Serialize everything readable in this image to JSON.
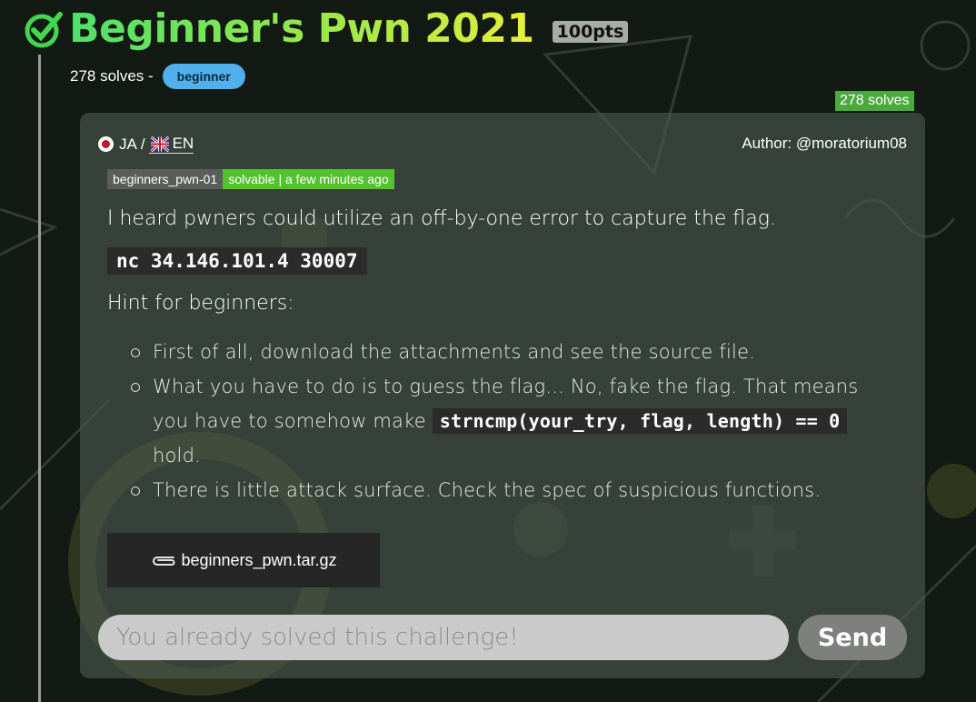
{
  "challenge": {
    "title": "Beginner's Pwn 2021",
    "points": "100pts",
    "solves_meta": "278 solves -",
    "tag": "beginner",
    "solves_badge": "278 solves"
  },
  "card": {
    "lang_ja": "JA",
    "lang_sep": "/",
    "lang_en": "EN",
    "author": "Author: @moratorium08",
    "status_id": "beginners_pwn-01",
    "status_text": "solvable | a few minutes ago",
    "description": "I heard pwners could utilize an off-by-one error to capture the flag.",
    "connection": "nc 34.146.101.4 30007",
    "hint_title": "Hint for beginners:",
    "hints": {
      "h1": "First of all, download the attachments and see the source file.",
      "h2_before": "What you have to do is to guess the flag... No, fake the flag. That means you have to somehow make",
      "h2_code": "strncmp(your_try, flag, length) == 0",
      "h2_after": "hold.",
      "h3": "There is little attack surface. Check the spec of suspicious functions."
    },
    "attachment": "beginners_pwn.tar.gz",
    "answer_placeholder": "You already solved this challenge!",
    "send_label": "Send"
  },
  "icons": {
    "check": "check-icon",
    "flag_jp": "japan-flag-icon",
    "flag_en": "uk-flag-icon",
    "attachment": "paperclip-icon"
  },
  "colors": {
    "title_gradient_start": "#4ee06a",
    "title_gradient_end": "#e8ee3c",
    "tag_bg": "#4fb0ec",
    "solves_badge_bg": "#4caa3c",
    "status_bg": "#52c230"
  }
}
